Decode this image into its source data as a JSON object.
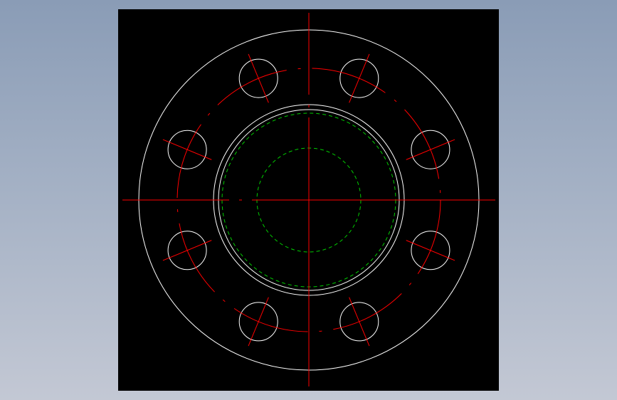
{
  "viewport": {
    "background": "#000000"
  },
  "drawing": {
    "type": "flange-front-view",
    "bolt_hole_count": 8,
    "bolt_angles_deg": [
      22.5,
      67.5,
      112.5,
      157.5,
      202.5,
      247.5,
      292.5,
      337.5
    ],
    "colors": {
      "outline": "#ffffff",
      "centerline": "#ff0000",
      "hidden": "#00cc00"
    }
  }
}
